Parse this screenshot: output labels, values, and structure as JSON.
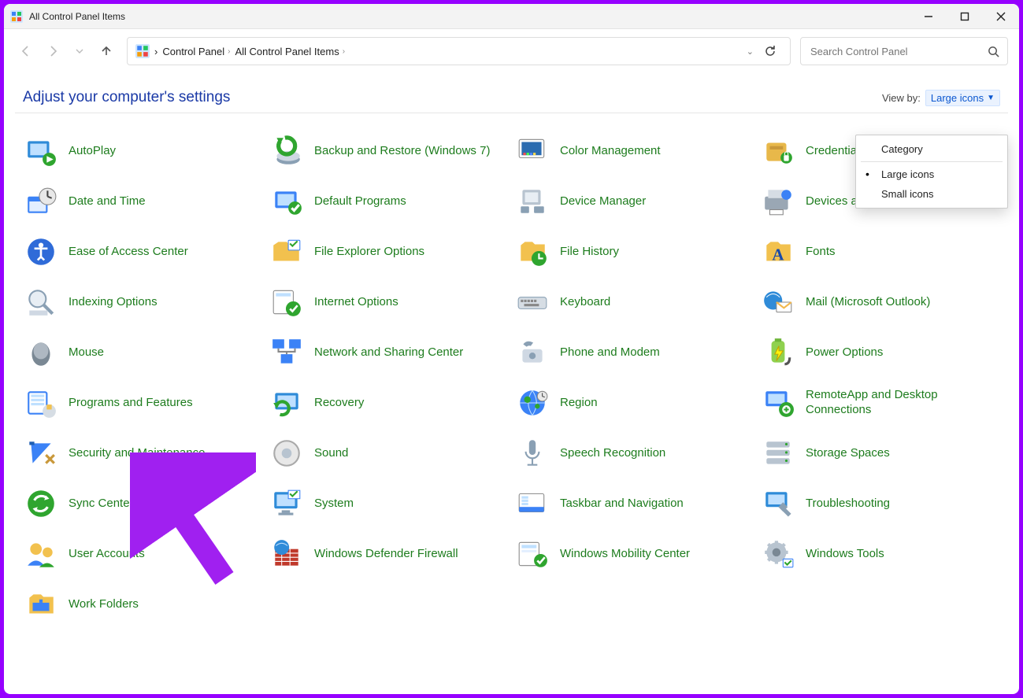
{
  "window": {
    "title": "All Control Panel Items",
    "minimize_tooltip": "Minimize",
    "maximize_tooltip": "Maximize",
    "close_tooltip": "Close"
  },
  "breadcrumb": {
    "root": "Control Panel",
    "current": "All Control Panel Items"
  },
  "search": {
    "placeholder": "Search Control Panel"
  },
  "heading": "Adjust your computer's settings",
  "view_by": {
    "label": "View by:",
    "selected": "Large icons",
    "options": [
      "Category",
      "Large icons",
      "Small icons"
    ],
    "selected_index": 1
  },
  "items": [
    {
      "id": "autoplay",
      "label": "AutoPlay"
    },
    {
      "id": "backup-restore",
      "label": "Backup and Restore (Windows 7)"
    },
    {
      "id": "color-mgmt",
      "label": "Color Management"
    },
    {
      "id": "credential-mgr",
      "label": "Credential Manager"
    },
    {
      "id": "date-time",
      "label": "Date and Time"
    },
    {
      "id": "default-programs",
      "label": "Default Programs"
    },
    {
      "id": "device-manager",
      "label": "Device Manager"
    },
    {
      "id": "devices-printers",
      "label": "Devices and Printers"
    },
    {
      "id": "ease-of-access",
      "label": "Ease of Access Center"
    },
    {
      "id": "file-explorer-opts",
      "label": "File Explorer Options"
    },
    {
      "id": "file-history",
      "label": "File History"
    },
    {
      "id": "fonts",
      "label": "Fonts"
    },
    {
      "id": "indexing-opts",
      "label": "Indexing Options"
    },
    {
      "id": "internet-opts",
      "label": "Internet Options"
    },
    {
      "id": "keyboard",
      "label": "Keyboard"
    },
    {
      "id": "mail",
      "label": "Mail (Microsoft Outlook)"
    },
    {
      "id": "mouse",
      "label": "Mouse"
    },
    {
      "id": "network-sharing",
      "label": "Network and Sharing Center"
    },
    {
      "id": "phone-modem",
      "label": "Phone and Modem"
    },
    {
      "id": "power-options",
      "label": "Power Options"
    },
    {
      "id": "programs-features",
      "label": "Programs and Features"
    },
    {
      "id": "recovery",
      "label": "Recovery"
    },
    {
      "id": "region",
      "label": "Region"
    },
    {
      "id": "remoteapp",
      "label": "RemoteApp and Desktop Connections"
    },
    {
      "id": "security-maintenance",
      "label": "Security and Maintenance"
    },
    {
      "id": "sound",
      "label": "Sound"
    },
    {
      "id": "speech-recognition",
      "label": "Speech Recognition"
    },
    {
      "id": "storage-spaces",
      "label": "Storage Spaces"
    },
    {
      "id": "sync-center",
      "label": "Sync Center"
    },
    {
      "id": "system",
      "label": "System"
    },
    {
      "id": "taskbar-nav",
      "label": "Taskbar and Navigation"
    },
    {
      "id": "troubleshooting",
      "label": "Troubleshooting"
    },
    {
      "id": "user-accounts",
      "label": "User Accounts"
    },
    {
      "id": "defender-firewall",
      "label": "Windows Defender Firewall"
    },
    {
      "id": "mobility-center",
      "label": "Windows Mobility Center"
    },
    {
      "id": "windows-tools",
      "label": "Windows Tools"
    },
    {
      "id": "work-folders",
      "label": "Work Folders"
    }
  ],
  "annotation": {
    "arrow_target_id": "programs-features",
    "arrow_color": "#a020f0"
  }
}
